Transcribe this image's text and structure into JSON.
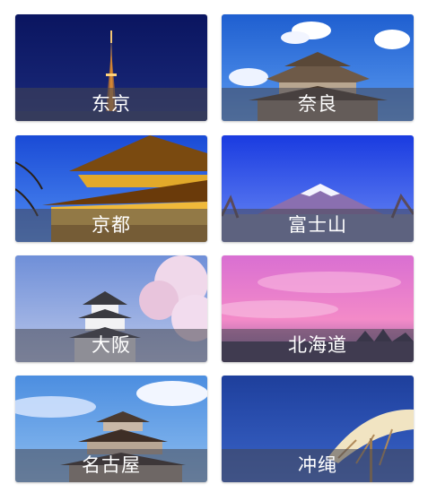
{
  "cities": [
    {
      "label": "东京"
    },
    {
      "label": "奈良"
    },
    {
      "label": "京都"
    },
    {
      "label": "富士山"
    },
    {
      "label": "大阪"
    },
    {
      "label": "北海道"
    },
    {
      "label": "名古屋"
    },
    {
      "label": "冲绳"
    }
  ]
}
